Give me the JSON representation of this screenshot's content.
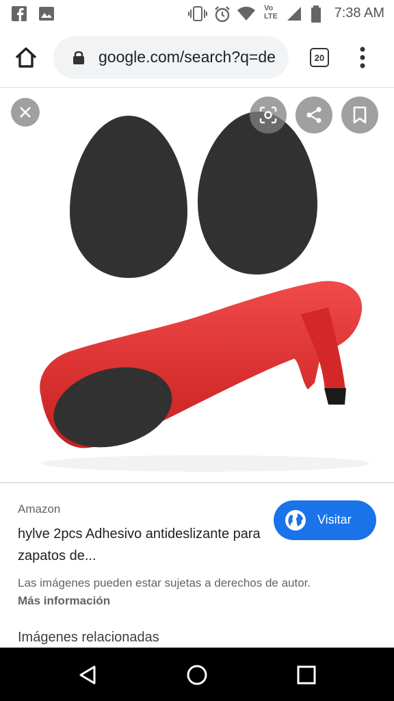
{
  "status_bar": {
    "time": "7:38 AM",
    "left_icons": [
      "facebook-icon",
      "gallery-icon"
    ],
    "right_icons": [
      "vibrate-icon",
      "alarm-icon",
      "wifi-icon",
      "volte-icon",
      "signal-icon",
      "battery-icon"
    ],
    "volte_label": "Vo\nLTE"
  },
  "browser": {
    "url": "google.com/search?q=de",
    "tab_count": "20"
  },
  "image_viewer": {
    "buttons": [
      "close-icon",
      "lens-icon",
      "share-icon",
      "bookmark-icon"
    ]
  },
  "result": {
    "source": "Amazon",
    "title": "hylve 2pcs Adhesivo antideslizante para zapatos de...",
    "visit_label": "Visitar",
    "copyright_notice": "Las imágenes pueden estar sujetas a derechos de autor.",
    "more_info": "Más información",
    "related_heading": "Imágenes relacionadas"
  },
  "colors": {
    "accent": "#1a73e8",
    "shoe_red": "#e32b2b",
    "pad_black": "#2a2a2a"
  }
}
